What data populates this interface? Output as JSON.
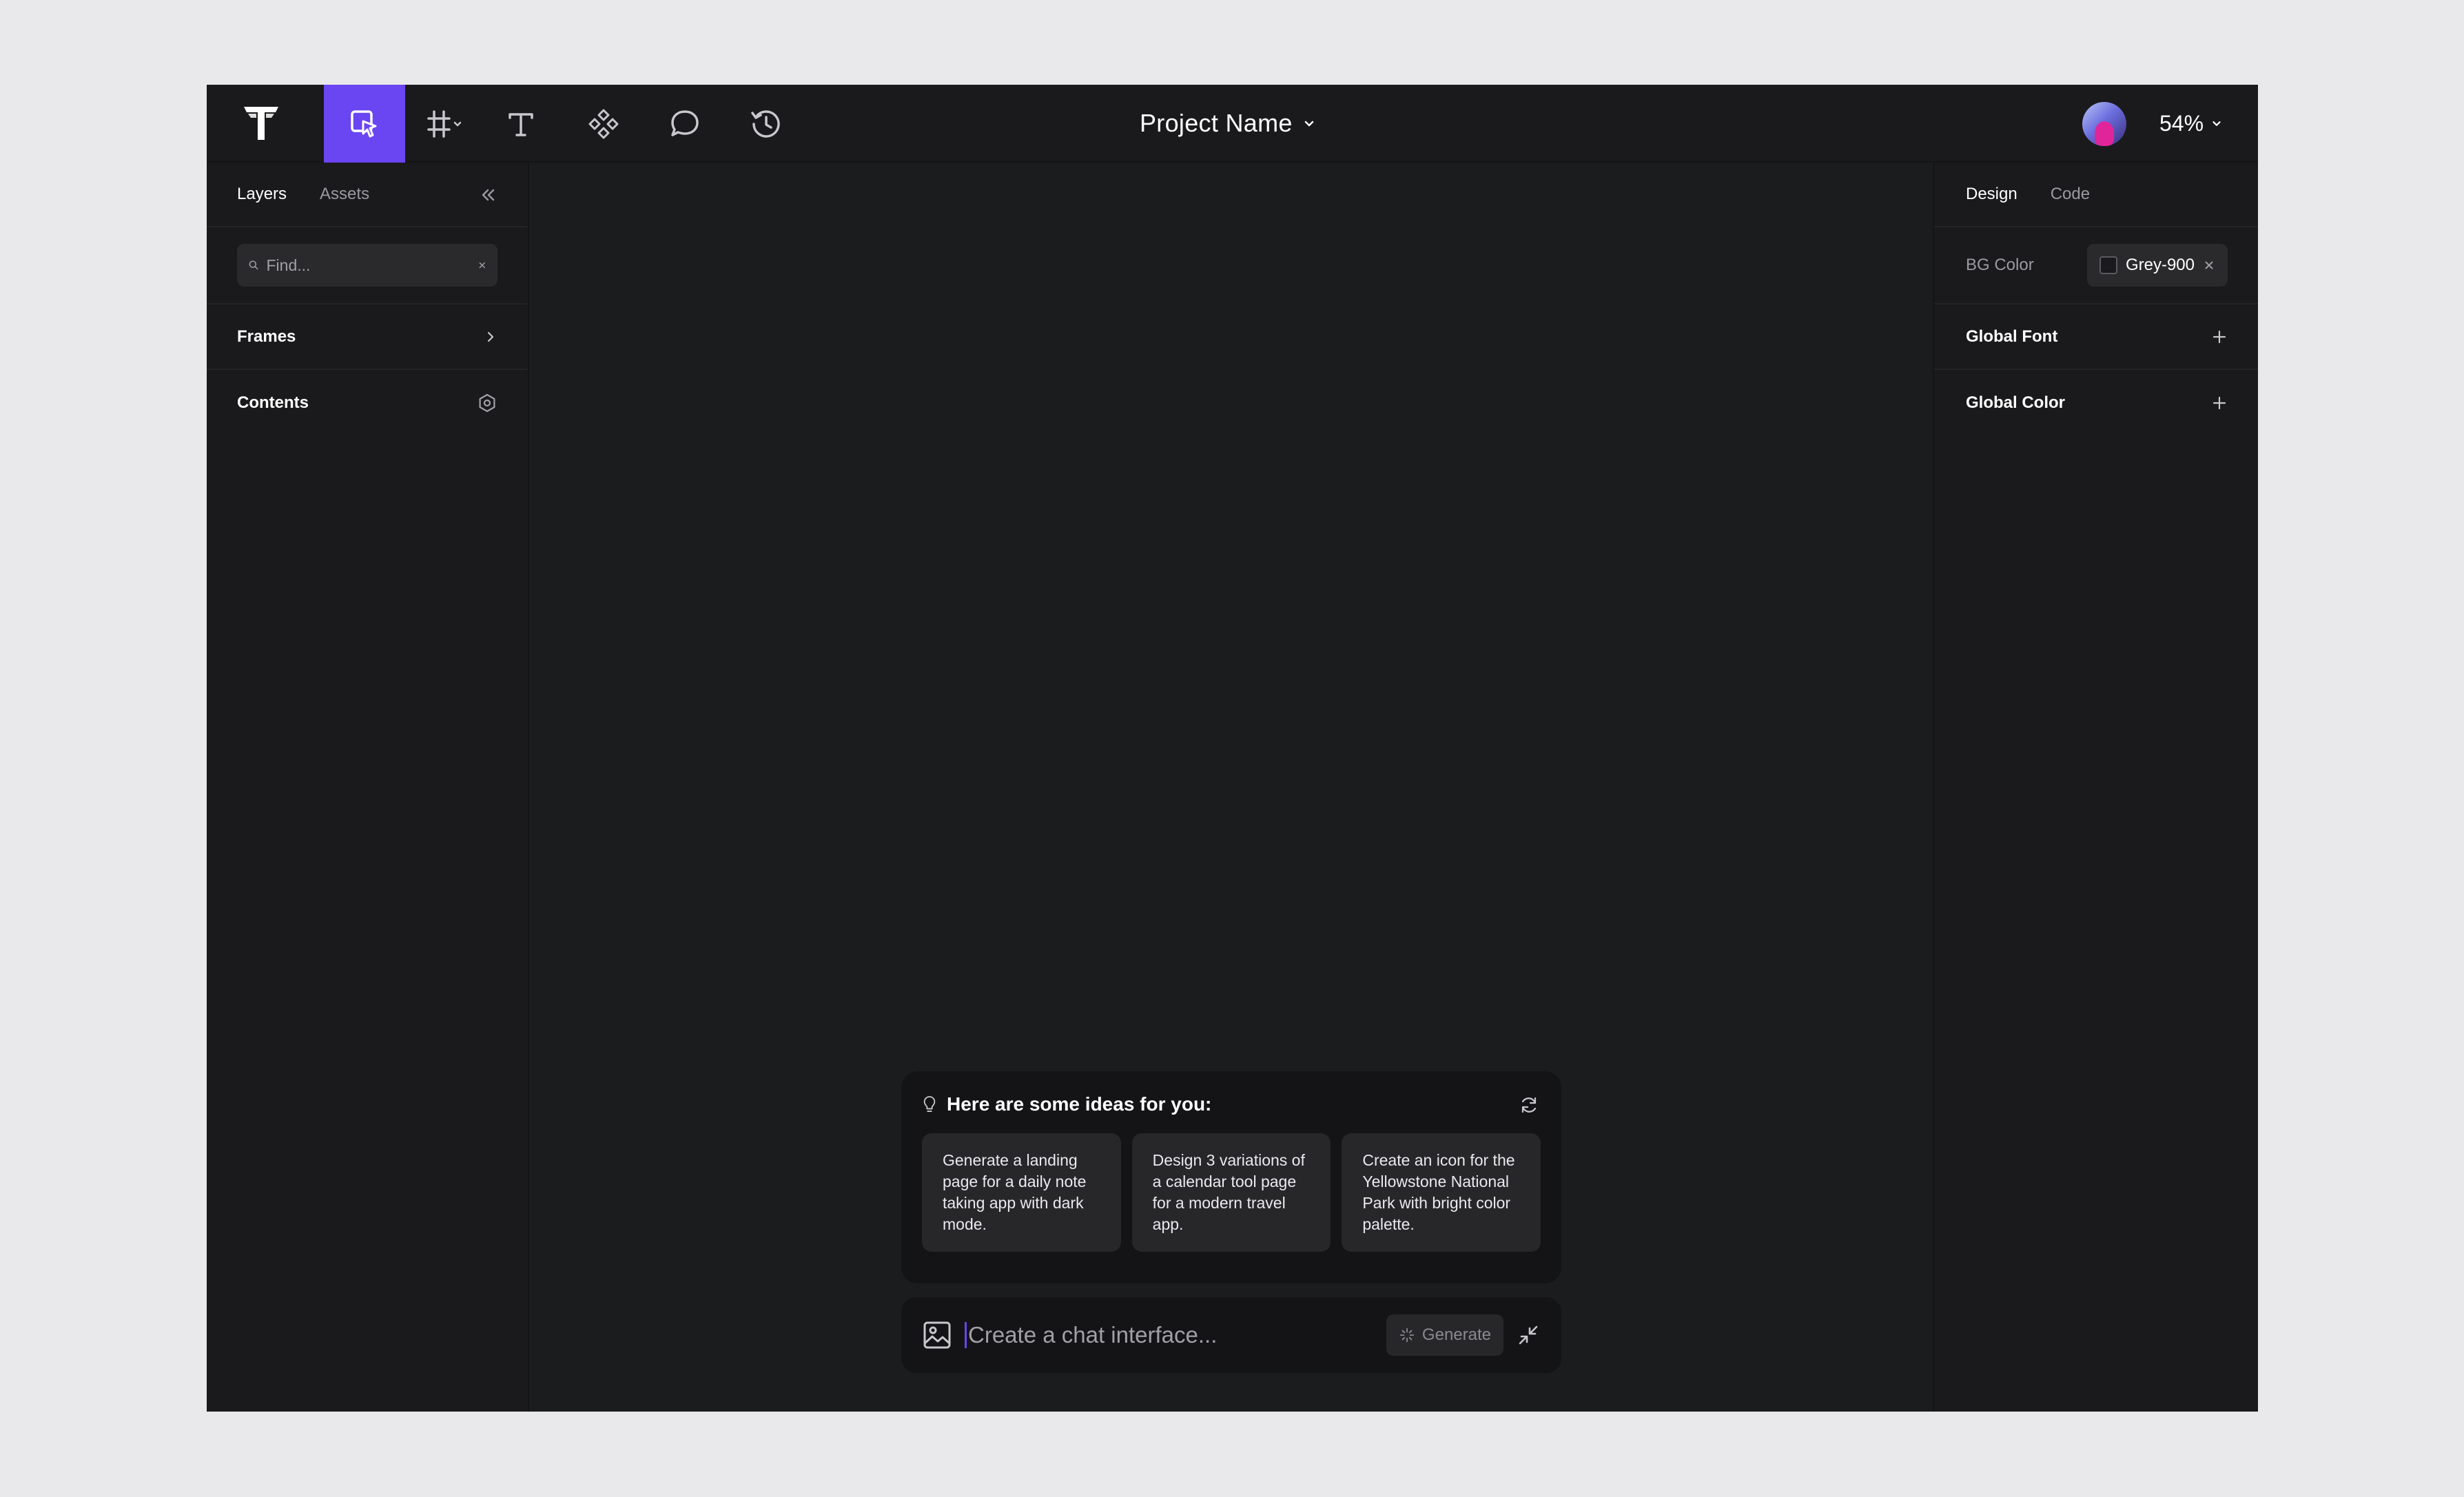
{
  "topbar": {
    "project_name": "Project Name",
    "zoom": "54%",
    "tools": [
      "select-tool",
      "frame-tool",
      "text-tool",
      "components-tool",
      "comment-tool",
      "history-tool"
    ]
  },
  "left_panel": {
    "tabs": [
      "Layers",
      "Assets"
    ],
    "search_placeholder": "Find...",
    "sections": [
      "Frames",
      "Contents"
    ]
  },
  "right_panel": {
    "tabs": [
      "Design",
      "Code"
    ],
    "bg_color_label": "BG Color",
    "bg_color_value": "Grey-900",
    "global_font_label": "Global Font",
    "global_color_label": "Global Color"
  },
  "ideas": {
    "title": "Here are some ideas for you:",
    "cards": [
      "Generate a landing page for a daily note taking app with dark mode.",
      "Design 3 variations of a calendar tool page for a modern travel app.",
      "Create an icon for the Yellowstone National Park with bright color palette."
    ]
  },
  "chat": {
    "placeholder": "Create a chat interface...",
    "generate_label": "Generate"
  },
  "colors": {
    "accent": "#6a45f2",
    "panel": "#1a1a1c",
    "canvas": "#1b1c1e",
    "page_bg": "#e9e9eb"
  }
}
